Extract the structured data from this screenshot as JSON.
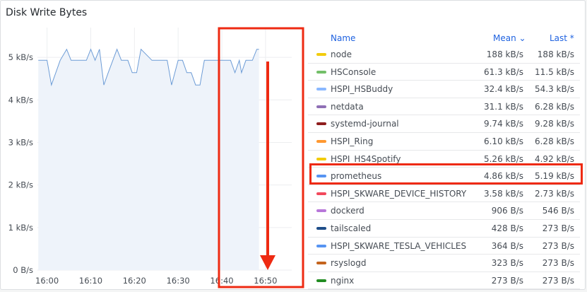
{
  "panel": {
    "title": "Disk Write Bytes"
  },
  "chart_data": {
    "type": "area",
    "title": "Disk Write Bytes",
    "y_ticks": [
      "0 B/s",
      "1 kB/s",
      "2 kB/s",
      "3 kB/s",
      "4 kB/s",
      "5 kB/s"
    ],
    "ylim": [
      0,
      5.7
    ],
    "x_ticks": [
      "16:00",
      "16:10",
      "16:20",
      "16:30",
      "16:40",
      "16:50"
    ],
    "x_tick_minutes": [
      0,
      10,
      20,
      30,
      40,
      50
    ],
    "xlim": [
      -2.2,
      56
    ],
    "grid": true,
    "line_color": "#6d9cd6",
    "fill_color": "#eef3fa",
    "series": [
      {
        "name": "prometheus",
        "x": [
          -2,
          0,
          1,
          3,
          4.5,
          5.5,
          7,
          9,
          10,
          11,
          12,
          13,
          14,
          16,
          17,
          18.5,
          19.5,
          20.5,
          21.5,
          24,
          26,
          27.5,
          28.5,
          30,
          31,
          32,
          33,
          34,
          35,
          36,
          37,
          38,
          40,
          41,
          42,
          43,
          44,
          44.5,
          45.5,
          46.5,
          47,
          48,
          48.5
        ],
        "values": [
          4.93,
          4.93,
          4.35,
          4.93,
          5.19,
          4.93,
          4.93,
          4.93,
          5.19,
          4.93,
          5.19,
          4.35,
          4.64,
          5.19,
          4.93,
          4.93,
          4.64,
          4.64,
          5.19,
          4.93,
          4.93,
          4.93,
          4.35,
          4.93,
          4.93,
          4.64,
          4.64,
          4.35,
          4.35,
          4.93,
          4.93,
          4.93,
          4.93,
          4.93,
          4.93,
          4.64,
          4.93,
          4.64,
          4.93,
          4.93,
          4.93,
          5.19,
          5.19
        ]
      }
    ]
  },
  "legend": {
    "header": {
      "name": "Name",
      "mean": "Mean ⌄",
      "last": "Last *"
    },
    "rows": [
      {
        "name": "node",
        "mean": "188 kB/s",
        "last": "188 kB/s",
        "color": "#f2cc0c"
      },
      {
        "name": "HSConsole",
        "mean": "61.3 kB/s",
        "last": "11.5 kB/s",
        "color": "#73bf69"
      },
      {
        "name": "HSPI_HSBuddy",
        "mean": "32.4 kB/s",
        "last": "54.3 kB/s",
        "color": "#8ab8ff"
      },
      {
        "name": "netdata",
        "mean": "31.1 kB/s",
        "last": "6.28 kB/s",
        "color": "#8f6fb5"
      },
      {
        "name": "systemd-journal",
        "mean": "9.74 kB/s",
        "last": "9.28 kB/s",
        "color": "#8e1d1d"
      },
      {
        "name": "HSPI_Ring",
        "mean": "6.10 kB/s",
        "last": "6.28 kB/s",
        "color": "#ff9830"
      },
      {
        "name": "HSPI_HS4Spotify",
        "mean": "5.26 kB/s",
        "last": "4.92 kB/s",
        "color": "#f2cc0c"
      },
      {
        "name": "prometheus",
        "mean": "4.86 kB/s",
        "last": "5.19 kB/s",
        "color": "#5794f2"
      },
      {
        "name": "HSPI_SKWARE_DEVICE_HISTORY",
        "mean": "3.58 kB/s",
        "last": "2.73 kB/s",
        "color": "#f2495c"
      },
      {
        "name": "dockerd",
        "mean": "906 B/s",
        "last": "546 B/s",
        "color": "#b877d9"
      },
      {
        "name": "tailscaled",
        "mean": "428 B/s",
        "last": "273 B/s",
        "color": "#1f4e89"
      },
      {
        "name": "HSPI_SKWARE_TESLA_VEHICLES",
        "mean": "364 B/s",
        "last": "273 B/s",
        "color": "#5794f2"
      },
      {
        "name": "rsyslogd",
        "mean": "323 B/s",
        "last": "273 B/s",
        "color": "#c4641d"
      },
      {
        "name": "nginx",
        "mean": "273 B/s",
        "last": "273 B/s",
        "color": "#228c22"
      }
    ]
  },
  "annotation_color": "#ee2a12"
}
